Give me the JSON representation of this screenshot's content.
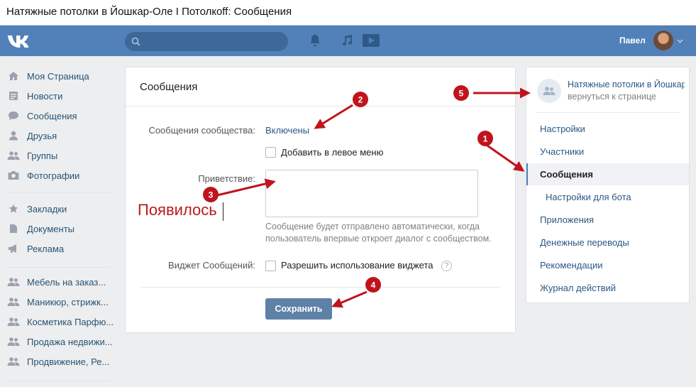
{
  "browser": {
    "title": "Натяжные потолки в Йошкар-Оле I Потолкoff: Сообщения"
  },
  "header": {
    "logo": "vk-logo",
    "user_name": "Павел",
    "icons": [
      "search-icon",
      "bell-icon",
      "music-icon",
      "video-icon"
    ]
  },
  "left_nav": {
    "main": [
      {
        "label": "Моя Страница",
        "icon": "home-icon"
      },
      {
        "label": "Новости",
        "icon": "news-icon"
      },
      {
        "label": "Сообщения",
        "icon": "chat-icon"
      },
      {
        "label": "Друзья",
        "icon": "user-icon"
      },
      {
        "label": "Группы",
        "icon": "users-icon"
      },
      {
        "label": "Фотографии",
        "icon": "camera-icon"
      }
    ],
    "extra": [
      {
        "label": "Закладки",
        "icon": "star-icon"
      },
      {
        "label": "Документы",
        "icon": "document-icon"
      },
      {
        "label": "Реклама",
        "icon": "megaphone-icon"
      }
    ],
    "groups": [
      {
        "label": "Мебель на заказ...",
        "icon": "users-icon"
      },
      {
        "label": "Маникюр, стрижк...",
        "icon": "users-icon"
      },
      {
        "label": "Косметика Парфю...",
        "icon": "users-icon"
      },
      {
        "label": "Продажа недвижи...",
        "icon": "users-icon"
      },
      {
        "label": "Продвижение, Ре...",
        "icon": "users-icon"
      }
    ]
  },
  "messages": {
    "title": "Сообщения",
    "community_label": "Сообщения сообщества:",
    "status": "Включены",
    "add_to_menu": "Добавить в левое меню",
    "greeting_label": "Приветствие:",
    "greeting_value": "",
    "greeting_hint": "Сообщение будет отправлено автоматически, когда пользователь впервые откроет диалог с сообществом.",
    "widget_label": "Виджет Сообщений:",
    "widget_option": "Разрешить использование виджета",
    "help": "?",
    "save": "Сохранить"
  },
  "annotation": {
    "appeared_text": "Появилось",
    "badges": [
      "1",
      "2",
      "3",
      "4",
      "5"
    ],
    "color": "#c0141c"
  },
  "right_panel": {
    "group_name": "Натяжные потолки в Йошкар-Оле",
    "back": "вернуться к странице",
    "menu": [
      {
        "label": "Настройки"
      },
      {
        "label": "Участники"
      },
      {
        "label": "Сообщения",
        "active": true
      },
      {
        "label": "Настройки для бота",
        "sub": true
      },
      {
        "label": "Приложения"
      },
      {
        "label": "Денежные переводы"
      },
      {
        "label": "Рекомендации"
      },
      {
        "label": "Журнал действий"
      }
    ]
  },
  "colors": {
    "header": "#5181b8",
    "link": "#2a5885",
    "button": "#5e81a8",
    "background": "#edeef0",
    "annotation": "#c0141c"
  }
}
